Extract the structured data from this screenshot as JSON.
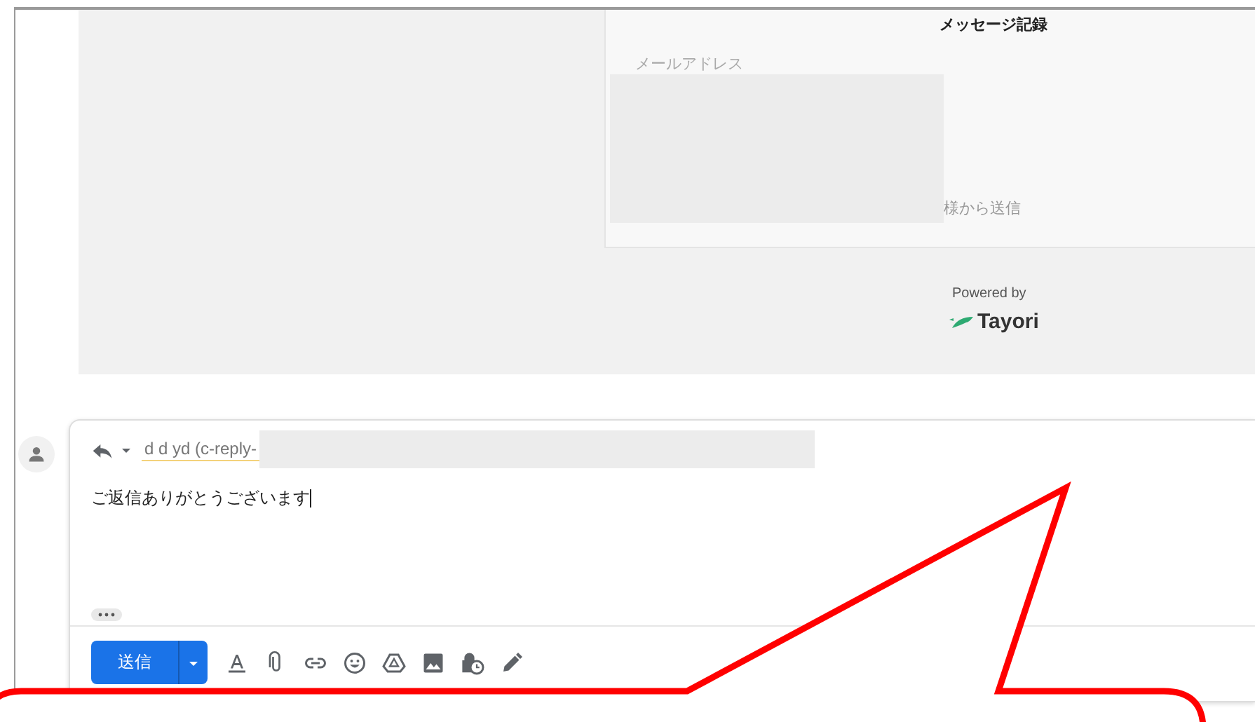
{
  "message_log": {
    "title": "メッセージ記録",
    "email_label": "メールアドレス",
    "sent_from": "様から送信"
  },
  "powered_by": {
    "text": "Powered by",
    "brand": "Tayori"
  },
  "compose": {
    "recipient": "d d yd (c-reply-",
    "body": "ご返信ありがとうございます",
    "send_button": "送信"
  }
}
